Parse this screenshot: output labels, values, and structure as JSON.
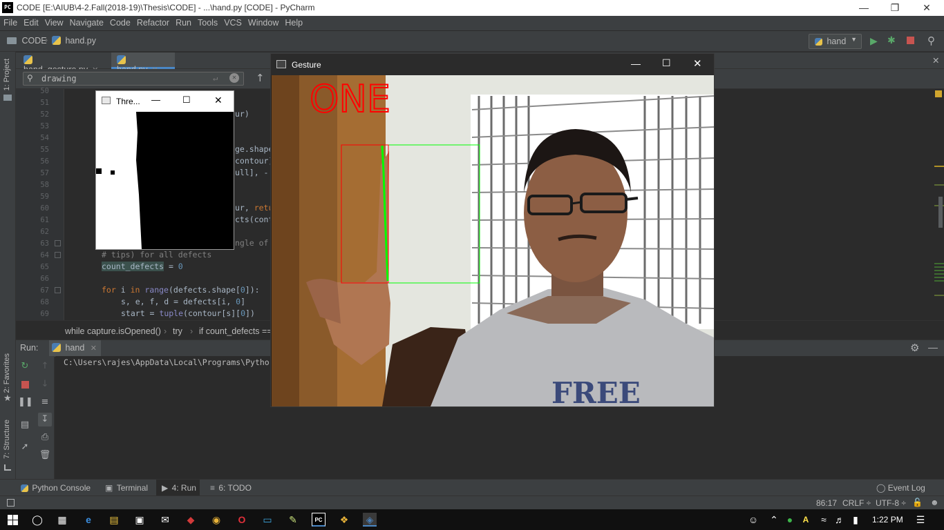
{
  "window": {
    "title": "CODE [E:\\AIUB\\4-2.Fall(2018-19)\\Thesis\\CODE] - ...\\hand.py [CODE] - PyCharm",
    "logo": "PC"
  },
  "menu": [
    "File",
    "Edit",
    "View",
    "Navigate",
    "Code",
    "Refactor",
    "Run",
    "Tools",
    "VCS",
    "Window",
    "Help"
  ],
  "nav": {
    "project": "CODE",
    "file": "hand.py",
    "run_config": "hand"
  },
  "tabs": [
    {
      "label": "hand_gesture.py",
      "active": false
    },
    {
      "label": "hand.py",
      "active": true
    }
  ],
  "search": {
    "value": "drawing"
  },
  "side_labels": {
    "project": "1: Project",
    "favorites": "2: Favorites",
    "structure": "7: Structure"
  },
  "gutter": [
    "50",
    "51",
    "52",
    "53",
    "54",
    "55",
    "56",
    "57",
    "58",
    "59",
    "60",
    "61",
    "62",
    "63",
    "64",
    "65",
    "66",
    "67",
    "68",
    "69"
  ],
  "code_fragments": {
    "l52": "ur)",
    "l55": "ge.shape",
    "l56": "contour]",
    "l57": "ull], -",
    "l60a": "ur, ",
    "l60b": "retu",
    "l61": "cts(cont",
    "l63": "ngle of",
    "l64": "# tips) for all defects",
    "l65a": "count_defects",
    "l65b": " = ",
    "l65c": "0",
    "l67a": "for",
    "l67b": " i ",
    "l67c": "in",
    "l67d": " ",
    "l67e": "range",
    "l67f": "(defects.shape[",
    "l67g": "0",
    "l67h": "]):",
    "l68a": "s, e, f, d = defects[i, ",
    "l68b": "0",
    "l68c": "]",
    "l69a": "start = ",
    "l69b": "tuple",
    "l69c": "(contour[s][",
    "l69d": "0",
    "l69e": "])"
  },
  "breadcrumbs": [
    "while capture.isOpened()",
    "try",
    "if count_defects =="
  ],
  "run_panel": {
    "label": "Run:",
    "tab": "hand",
    "output": "C:\\Users\\rajes\\AppData\\Local\\Programs\\Pytho"
  },
  "bottom_tabs": [
    "Python Console",
    "Terminal",
    "4: Run",
    "6: TODO"
  ],
  "event_log": "Event Log",
  "status": {
    "position": "86:17",
    "line_sep": "CRLF ÷",
    "encoding": "UTF-8 ÷"
  },
  "taskbar": {
    "time": "1:22 PM"
  },
  "threshold_window": {
    "title": "Thre..."
  },
  "gesture_window": {
    "title": "Gesture",
    "overlay_text": "ONE"
  },
  "colors": {
    "accent": "#4a88c7",
    "run_green": "#59a869",
    "stop_red": "#c75450",
    "overlay_red": "#ff0000",
    "roi_green": "#00ff00"
  }
}
